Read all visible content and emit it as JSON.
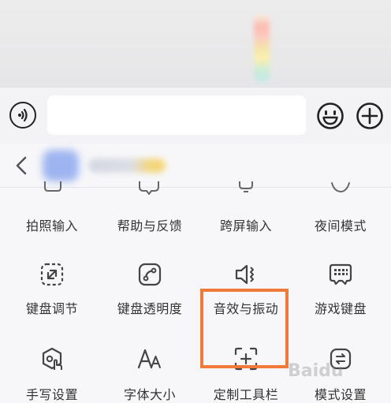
{
  "input_bar": {
    "placeholder": ""
  },
  "panel": {
    "back_icon": "chevron-left-icon",
    "items": [
      {
        "label": "拍照输入",
        "icon": "camera-icon"
      },
      {
        "label": "帮助与反馈",
        "icon": "help-icon"
      },
      {
        "label": "跨屏输入",
        "icon": "cross-screen-icon"
      },
      {
        "label": "夜间模式",
        "icon": "moon-icon"
      },
      {
        "label": "键盘调节",
        "icon": "resize-icon"
      },
      {
        "label": "键盘透明度",
        "icon": "transparency-icon"
      },
      {
        "label": "音效与振动",
        "icon": "sound-vibration-icon"
      },
      {
        "label": "游戏键盘",
        "icon": "game-keyboard-icon"
      },
      {
        "label": "手写设置",
        "icon": "handwriting-icon"
      },
      {
        "label": "字体大小",
        "icon": "font-size-icon"
      },
      {
        "label": "定制工具栏",
        "icon": "custom-toolbar-icon"
      },
      {
        "label": "模式设置",
        "icon": "mode-icon"
      }
    ]
  },
  "highlight_color": "#f07a3a",
  "watermark": {
    "text": "Baidu"
  }
}
